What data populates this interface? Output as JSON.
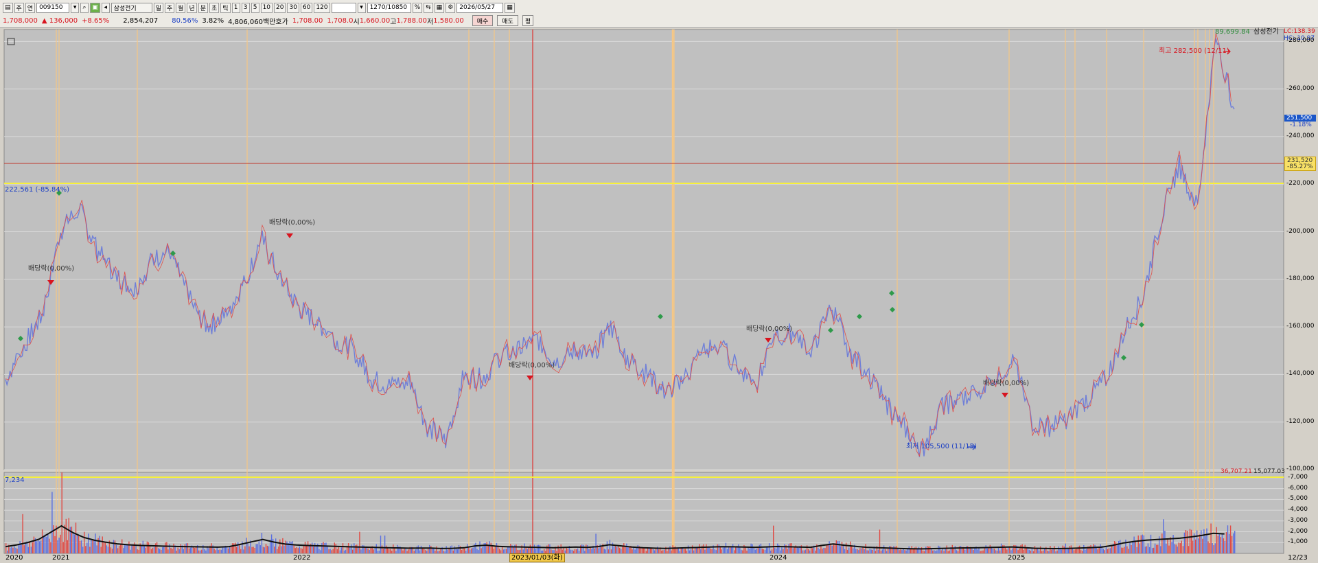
{
  "toolbar": {
    "period_buttons": [
      "주",
      "연"
    ],
    "code": "009150",
    "name": "삼성전기",
    "tabs": [
      "일",
      "주",
      "월",
      "년",
      "분",
      "초",
      "틱"
    ],
    "intervals": [
      "1",
      "3",
      "5",
      "10",
      "20",
      "30",
      "60",
      "120"
    ],
    "count": "1270/10850",
    "date": "2026/05/27"
  },
  "quote": {
    "price": "1,708,000",
    "change": "▲ 136,000",
    "change_rate": "+8.65%",
    "volume": "2,854,207",
    "vol_ratio": "80.56%",
    "turnover_rate": "3.82%",
    "amount": "4,806,060백만",
    "ask_label": "호가",
    "ask1": "1,708.00",
    "ask2": "1,708.0",
    "open_label": "시",
    "open": "1,660.00",
    "high_label": "고",
    "high": "1,788.00",
    "low_label": "저",
    "low": "1,580.00",
    "buy": "매수",
    "sell": "매도",
    "avg": "평"
  },
  "price_panel": {
    "legend_value": "89,699.84",
    "legend_name": "삼성전기",
    "lc": "LC:138.39",
    "hc": "HC:-10.97",
    "current_price": "251,500",
    "current_change": "-1.18%",
    "hline_price": "231,520",
    "hline_change": "-85.27%",
    "yellow_label": "222,561 (-85.84%)",
    "max_label": "최고 282,500 (12/11)",
    "min_label": "최저 105,500 (11/15)",
    "dividend_label": "배당락(0,00%)",
    "y_ticks": [
      "280,000",
      "260,000",
      "240,000",
      "220,000",
      "200,000",
      "180,000",
      "160,000",
      "140,000",
      "120,000",
      "100,000"
    ]
  },
  "volume_panel": {
    "legend_value": "36,707.21",
    "legend_value2": "15,077.03",
    "left_label": "7,234",
    "y_ticks": [
      "7,000",
      "6,000",
      "5,000",
      "4,000",
      "3,000",
      "2,000",
      "1,000"
    ]
  },
  "x_axis": {
    "labels": [
      "2020",
      "2021",
      "2022",
      "2023/01/03(화)",
      "2024",
      "2025",
      "12/23"
    ]
  },
  "chart_data": {
    "type": "line",
    "series": [
      {
        "name": "삼성전기",
        "x": [
          "2020-10",
          "2020-11",
          "2020-12",
          "2021-01",
          "2021-02",
          "2021-03",
          "2021-04",
          "2021-05",
          "2021-06",
          "2021-07",
          "2021-08",
          "2021-09",
          "2021-10",
          "2021-11",
          "2021-12",
          "2022-01",
          "2022-02",
          "2022-03",
          "2022-04",
          "2022-05",
          "2022-06",
          "2022-07",
          "2022-08",
          "2022-09",
          "2022-10",
          "2022-11",
          "2022-12",
          "2023-01",
          "2023-02",
          "2023-03",
          "2023-04",
          "2023-05",
          "2023-06",
          "2023-07",
          "2023-08",
          "2023-09",
          "2023-10",
          "2023-11",
          "2023-12",
          "2024-01",
          "2024-02",
          "2024-03",
          "2024-04",
          "2024-05",
          "2024-06",
          "2024-07",
          "2024-08",
          "2024-09",
          "2024-10",
          "2024-11",
          "2024-12",
          "2025-01",
          "2025-02",
          "2025-03",
          "2025-04",
          "2025-05",
          "2025-06",
          "2025-07",
          "2025-08",
          "2025-09",
          "2025-10",
          "2025-11",
          "2025-12",
          "2026-01",
          "2026-02",
          "2026-03",
          "2026-04",
          "2026-05"
        ],
        "values": [
          138000,
          152000,
          165000,
          200000,
          210000,
          192000,
          182000,
          175000,
          188000,
          192000,
          172000,
          160000,
          165000,
          178000,
          197000,
          180000,
          168000,
          162000,
          155000,
          150000,
          138000,
          135000,
          138000,
          118000,
          112000,
          140000,
          138000,
          148000,
          150000,
          155000,
          145000,
          150000,
          148000,
          160000,
          146000,
          140000,
          132000,
          138000,
          150000,
          152000,
          142000,
          138000,
          155000,
          158000,
          150000,
          170000,
          150000,
          140000,
          128000,
          118000,
          108000,
          126000,
          130000,
          132000,
          140000,
          145000,
          120000,
          118000,
          122000,
          130000,
          138000,
          158000,
          172000,
          205000,
          228000,
          210000,
          282500,
          251500
        ]
      }
    ],
    "ylim": [
      100000,
      285000
    ],
    "max": {
      "value": 282500,
      "date": "12/11"
    },
    "min": {
      "value": 105500,
      "date": "11/15"
    },
    "hlines": [
      231520,
      222561
    ],
    "volume": {
      "ylim": [
        0,
        7500
      ],
      "values": [
        620,
        900,
        1400,
        2600,
        1600,
        1150,
        900,
        750,
        700,
        650,
        620,
        600,
        560,
        900,
        1300,
        900,
        760,
        700,
        650,
        600,
        560,
        520,
        480,
        500,
        440,
        520,
        800,
        620,
        600,
        560,
        520,
        600,
        540,
        820,
        600,
        500,
        460,
        520,
        560,
        620,
        600,
        560,
        640,
        600,
        560,
        900,
        700,
        560,
        500,
        440,
        420,
        460,
        500,
        520,
        560,
        600,
        480,
        440,
        460,
        520,
        600,
        980,
        1200,
        1300,
        1400,
        1600,
        1900,
        1700
      ]
    }
  }
}
